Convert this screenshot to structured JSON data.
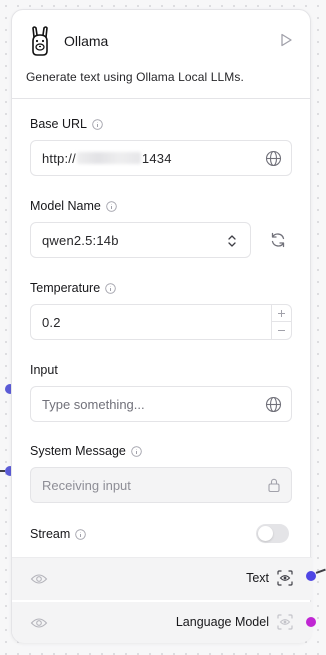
{
  "node": {
    "title": "Ollama",
    "description": "Generate text using Ollama Local LLMs.",
    "logo_icon": "llama-icon",
    "run_icon": "play-icon"
  },
  "fields": {
    "base_url": {
      "label": "Base URL",
      "value_prefix": "http://",
      "value_suffix": "1434"
    },
    "model_name": {
      "label": "Model Name",
      "value": "qwen2.5:14b"
    },
    "temperature": {
      "label": "Temperature",
      "value": "0.2"
    },
    "input": {
      "label": "Input",
      "placeholder": "Type something..."
    },
    "system_message": {
      "label": "System Message",
      "placeholder": "Receiving input"
    },
    "stream": {
      "label": "Stream",
      "enabled": false
    }
  },
  "outputs": {
    "text": {
      "label": "Text"
    },
    "language_model": {
      "label": "Language Model"
    }
  },
  "colors": {
    "input_handle": "#5b5bd6",
    "text_output_handle": "#4f46e5",
    "language_model_handle": "#c026d3"
  }
}
